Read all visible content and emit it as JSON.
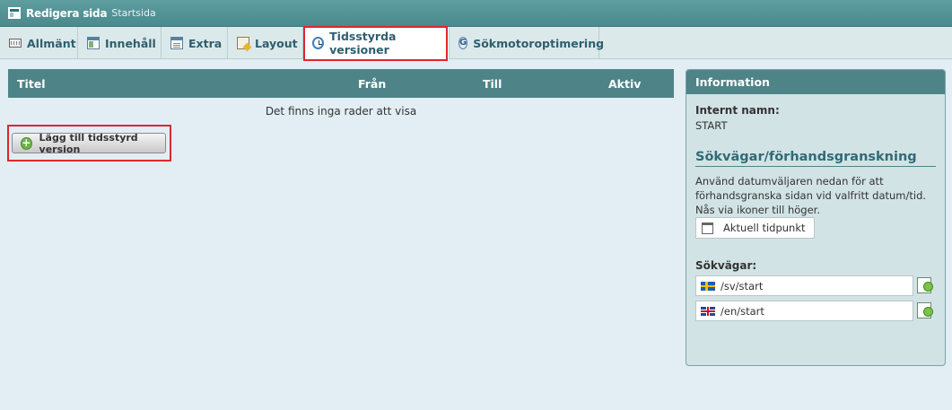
{
  "window": {
    "title": "Redigera sida",
    "subtitle": "Startsida"
  },
  "tabs": [
    {
      "label": "Allmänt",
      "icon": "keyboard-icon"
    },
    {
      "label": "Innehåll",
      "icon": "window-icon"
    },
    {
      "label": "Extra",
      "icon": "form-icon"
    },
    {
      "label": "Layout",
      "icon": "layout-icon"
    },
    {
      "label": "Tidsstyrda versioner",
      "icon": "clock-icon",
      "active": true
    },
    {
      "label": "Sökmotoroptimering",
      "icon": "google-icon"
    }
  ],
  "grid": {
    "columns": [
      "Titel",
      "Från",
      "Till",
      "Aktiv"
    ],
    "empty_message": "Det finns inga rader att visa"
  },
  "add_button": {
    "label": "Lägg till tidsstyrd version"
  },
  "info": {
    "title": "Information",
    "internal_name_label": "Internt namn:",
    "internal_name_value": "START",
    "paths_section_title": "Sökvägar/förhandsgranskning",
    "description": "Använd datumväljaren nedan för att förhandsgranska sidan vid valfritt datum/tid. Nås via ikoner till höger.",
    "date_button": "Aktuell tidpunkt",
    "paths_label": "Sökvägar:",
    "paths": [
      {
        "flag": "sweden-flag",
        "value": "/sv/start"
      },
      {
        "flag": "uk-flag",
        "value": "/en/start"
      }
    ]
  },
  "colors": {
    "header_teal": "#4e8488",
    "background": "#e2eef4",
    "highlight_red": "#e0262b",
    "tab_text": "#2d5f6e"
  }
}
